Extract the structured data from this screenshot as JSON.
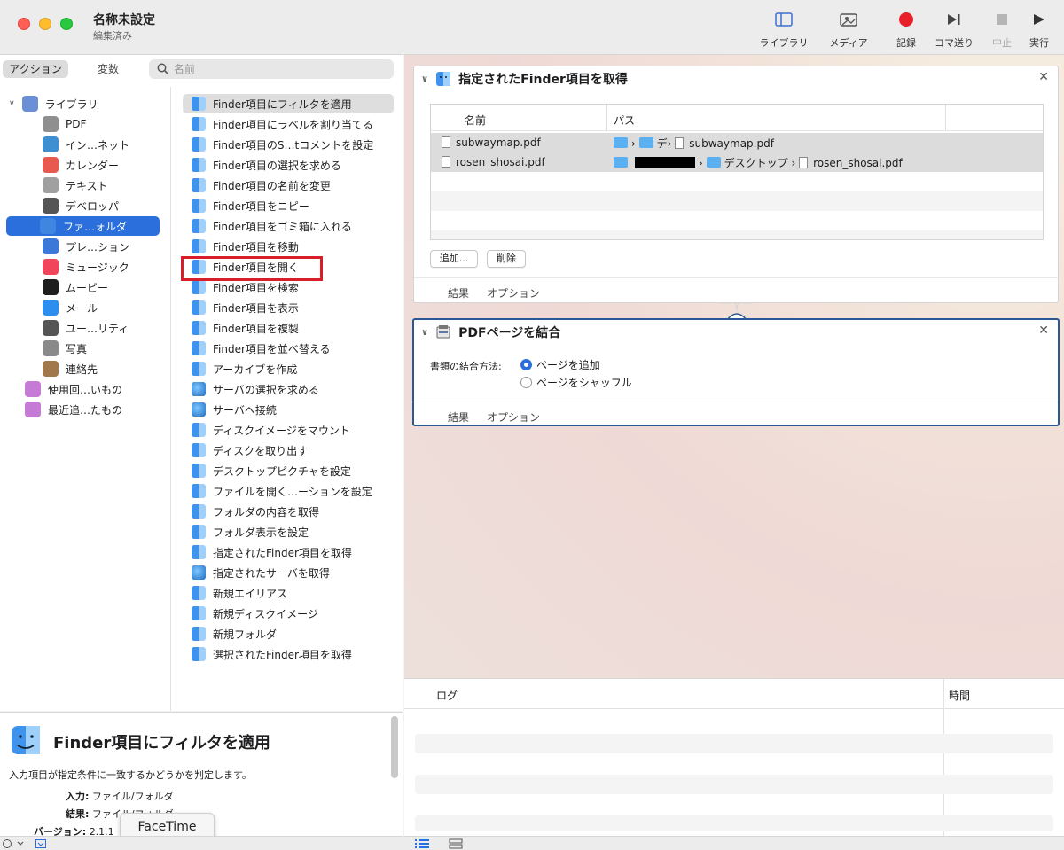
{
  "window": {
    "title": "名称未設定",
    "subtitle": "編集済み"
  },
  "toolbar": {
    "library": "ライブラリ",
    "media": "メディア",
    "record": "記録",
    "step": "コマ送り",
    "stop": "中止",
    "run": "実行"
  },
  "library_pane": {
    "tab_actions": "アクション",
    "tab_variables": "変数",
    "search_placeholder": "名前",
    "categories": [
      {
        "label": "ライブラリ",
        "icon": "library-icon",
        "color": "#6b8fd6"
      },
      {
        "label": "PDF",
        "icon": "pdf-icon",
        "color": "#8f8f8f"
      },
      {
        "label": "イン…ネット",
        "icon": "internet-icon",
        "color": "#3d8fd1"
      },
      {
        "label": "カレンダー",
        "icon": "calendar-icon",
        "color": "#e85a4f"
      },
      {
        "label": "テキスト",
        "icon": "text-icon",
        "color": "#a0a0a0"
      },
      {
        "label": "デベロッパ",
        "icon": "developer-icon",
        "color": "#555555"
      },
      {
        "label": "ファ…ォルダ",
        "icon": "finder-icon",
        "color": "#3f86e0"
      },
      {
        "label": "プレ…ション",
        "icon": "presentation-icon",
        "color": "#3b78d8"
      },
      {
        "label": "ミュージック",
        "icon": "music-icon",
        "color": "#f0455a"
      },
      {
        "label": "ムービー",
        "icon": "movie-icon",
        "color": "#1e1e1e"
      },
      {
        "label": "メール",
        "icon": "mail-icon",
        "color": "#2d8ef0"
      },
      {
        "label": "ユー…リティ",
        "icon": "utility-icon",
        "color": "#555555"
      },
      {
        "label": "写真",
        "icon": "photos-icon",
        "color": "#8a8a8a"
      },
      {
        "label": "連絡先",
        "icon": "contacts-icon",
        "color": "#a0784b"
      },
      {
        "label": "使用回…いもの",
        "icon": "smart-folder-icon",
        "color": "#c57ad6"
      },
      {
        "label": "最近追…たもの",
        "icon": "smart-folder-icon",
        "color": "#c57ad6"
      }
    ],
    "actions": [
      "Finder項目にフィルタを適用",
      "Finder項目にラベルを割り当てる",
      "Finder項目のS…tコメントを設定",
      "Finder項目の選択を求める",
      "Finder項目の名前を変更",
      "Finder項目をコピー",
      "Finder項目をゴミ箱に入れる",
      "Finder項目を移動",
      "Finder項目を開く",
      "Finder項目を検索",
      "Finder項目を表示",
      "Finder項目を複製",
      "Finder項目を並べ替える",
      "アーカイブを作成",
      "サーバの選択を求める",
      "サーバへ接続",
      "ディスクイメージをマウント",
      "ディスクを取り出す",
      "デスクトップピクチャを設定",
      "ファイルを開く…ーションを設定",
      "フォルダの内容を取得",
      "フォルダ表示を設定",
      "指定されたFinder項目を取得",
      "指定されたサーバを取得",
      "新規エイリアス",
      "新規ディスクイメージ",
      "新規フォルダ",
      "選択されたFinder項目を取得"
    ]
  },
  "description": {
    "title": "Finder項目にフィルタを適用",
    "text": "入力項目が指定条件に一致するかどうかを判定します。",
    "input_label": "入力:",
    "input_value": "ファイル/フォルダ",
    "result_label": "結果:",
    "result_value": "ファイル/フォルダ",
    "version_label": "バージョン:",
    "version_value": "2.1.1",
    "tooltip": "FaceTime"
  },
  "workflow": {
    "card1": {
      "title": "指定されたFinder項目を取得",
      "col_name": "名前",
      "col_path": "パス",
      "rows": [
        {
          "name": "subwaymap.pdf",
          "path_mid": "デ›",
          "path_file": "subwaymap.pdf"
        },
        {
          "name": "rosen_shosai.pdf",
          "path_mid": "デスクトップ ›",
          "path_file": "rosen_shosai.pdf"
        }
      ],
      "add_button": "追加...",
      "delete_button": "削除",
      "tab_results": "結果",
      "tab_options": "オプション"
    },
    "card2": {
      "title": "PDFページを結合",
      "method_label": "書類の結合方法:",
      "option1": "ページを追加",
      "option2": "ページをシャッフル",
      "tab_results": "結果",
      "tab_options": "オプション"
    }
  },
  "log": {
    "col_log": "ログ",
    "col_time": "時間"
  }
}
